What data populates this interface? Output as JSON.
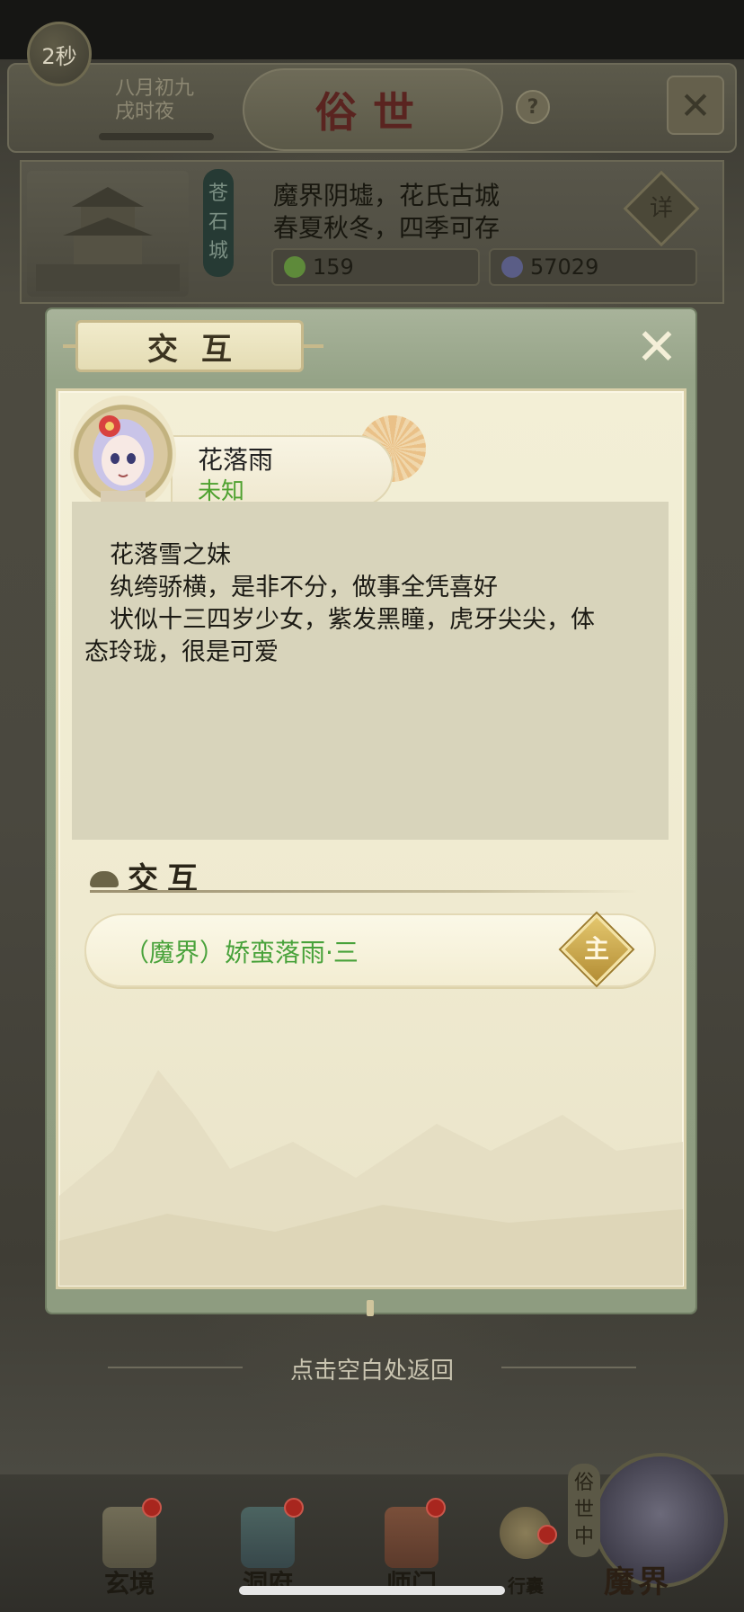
{
  "header": {
    "timer": "2秒",
    "date_line1": "八月初九",
    "date_line2": "戌时夜",
    "title": "俗世",
    "help": "?"
  },
  "location": {
    "city_name": [
      "苍",
      "石",
      "城"
    ],
    "desc_line1": "魔界阴墟，花氏古城",
    "desc_line2": "春夏秋冬，四季可存",
    "detail_badge": "详",
    "resource1": "159",
    "resource2": "57029"
  },
  "modal": {
    "title": "交互",
    "character": {
      "name": "花落雨",
      "status": "未知"
    },
    "description": [
      "花落雪之妹",
      "纨绔骄横，是非不分，做事全凭喜好",
      "状似十三四岁少女，紫发黑瞳，虎牙尖尖，体",
      "态玲珑，很是可爱"
    ],
    "section_title": "交互",
    "interaction": {
      "label": "（魔界）娇蛮落雨·三",
      "badge": "主"
    }
  },
  "return_hint": "点击空白处返回",
  "bottom_nav": {
    "items": [
      {
        "label": "玄境"
      },
      {
        "label": "洞府"
      },
      {
        "label": "师门"
      },
      {
        "label": "行囊"
      }
    ],
    "vertical_tag": [
      "俗",
      "世",
      "中"
    ],
    "mojie": "魔界"
  },
  "colors": {
    "accent_green": "#4ea12f",
    "title_red": "#5a2420",
    "badge_gold": "#c9a64a"
  }
}
